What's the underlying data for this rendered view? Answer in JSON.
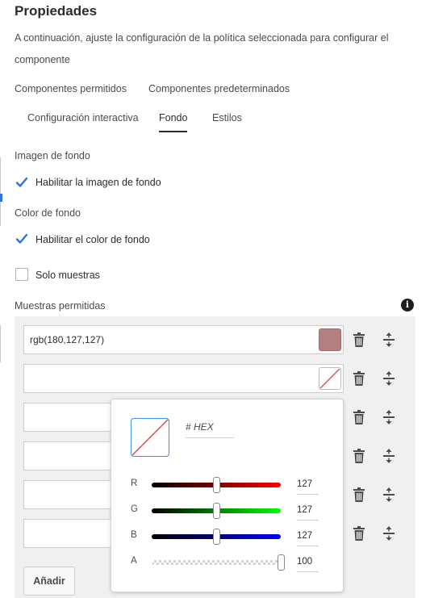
{
  "header": {
    "title": "Propiedades",
    "description": "A continuación, ajuste la configuración de la política seleccionada para configurar el componente"
  },
  "tabs_row1": [
    "Componentes permitidos",
    "Componentes predeterminados"
  ],
  "tabs_row2": [
    "Configuración interactiva",
    "Fondo",
    "Estilos"
  ],
  "active_tab": "Fondo",
  "background_image": {
    "section_label": "Imagen de fondo",
    "enable_label": "Habilitar la imagen de fondo",
    "enabled": true
  },
  "background_color": {
    "section_label": "Color de fondo",
    "enable_label": "Habilitar el color de fondo",
    "enabled": true,
    "swatches_only_label": "Solo muestras",
    "swatches_only": false
  },
  "allowed_swatches": {
    "label": "Muestras permitidas",
    "rows": [
      {
        "value": "rgb(180,127,127)",
        "color": "#b47f7f"
      },
      {
        "value": "",
        "color": ""
      },
      {
        "value": "",
        "color": ""
      },
      {
        "value": "",
        "color": ""
      },
      {
        "value": "",
        "color": ""
      },
      {
        "value": "",
        "color": ""
      }
    ],
    "add_label": "Añadir"
  },
  "color_picker": {
    "hex_placeholder": "# HEX",
    "channels": [
      {
        "name": "R",
        "value": "127",
        "level": 0.5
      },
      {
        "name": "G",
        "value": "127",
        "level": 0.5
      },
      {
        "name": "B",
        "value": "127",
        "level": 0.5
      },
      {
        "name": "A",
        "value": "100",
        "level": 1.0
      }
    ]
  },
  "colors": {
    "accent": "#3b8ee8",
    "checkbox": "#2d74d4",
    "empty_swatch_slash": "#e34850"
  },
  "icons": [
    "checkmark-icon",
    "info-icon",
    "trash-icon",
    "drag-handle-icon"
  ]
}
